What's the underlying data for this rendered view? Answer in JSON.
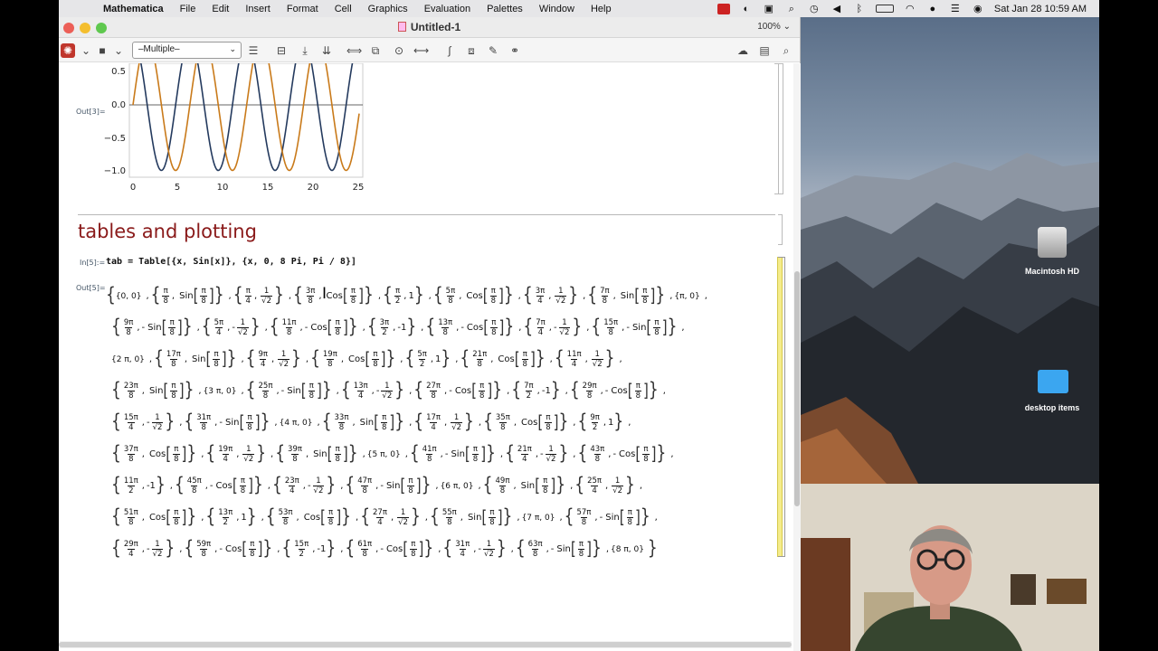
{
  "menubar": {
    "app": "Mathematica",
    "items": [
      "File",
      "Edit",
      "Insert",
      "Format",
      "Cell",
      "Graphics",
      "Evaluation",
      "Palettes",
      "Window",
      "Help"
    ],
    "datetime": "Sat Jan 28  10:59 AM"
  },
  "window": {
    "title": "Untitled-1",
    "zoom": "100%"
  },
  "toolbar": {
    "style_value": "–Multiple–"
  },
  "plot": {
    "out_label": "Out[3]=",
    "yticks": [
      "0.5",
      "0.0",
      "−0.5",
      "−1.0"
    ],
    "xticks": [
      "0",
      "5",
      "10",
      "15",
      "20",
      "25"
    ]
  },
  "section": {
    "title": "tables and plotting"
  },
  "input": {
    "label": "In[5]:=",
    "code": "tab = Table[{x, Sin[x]}, {x, 0, 8 Pi, Pi / 8}]"
  },
  "output": {
    "label": "Out[5]="
  },
  "desktop": {
    "icons": [
      {
        "label": "Macintosh HD"
      },
      {
        "label": "desktop items"
      }
    ]
  },
  "colors": {
    "series1": "#243a5e",
    "series2": "#c97a1a",
    "section_title": "#8a1a1a"
  }
}
